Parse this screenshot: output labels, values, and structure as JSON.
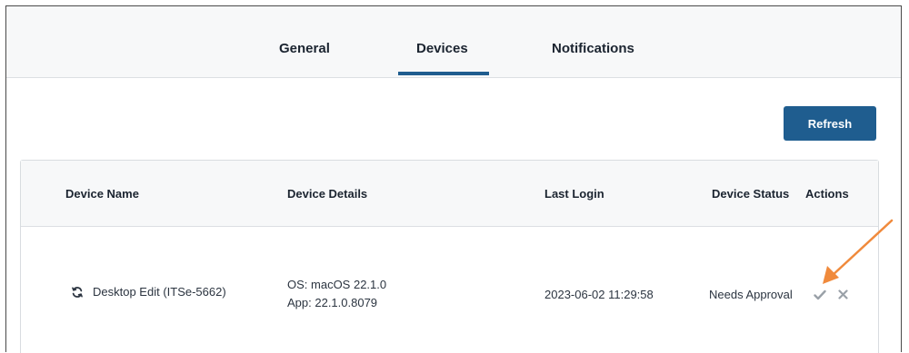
{
  "tabs": [
    {
      "label": "General",
      "active": false
    },
    {
      "label": "Devices",
      "active": true
    },
    {
      "label": "Notifications",
      "active": false
    }
  ],
  "toolbar": {
    "refresh_label": "Refresh"
  },
  "table": {
    "headers": [
      "Device Name",
      "Device Details",
      "Last Login",
      "Device Status",
      "Actions"
    ],
    "rows": [
      {
        "device_name": "Desktop Edit (ITSe-5662)",
        "details_os": "OS: macOS 22.1.0",
        "details_app": "App: 22.1.0.8079",
        "last_login": "2023-06-02 11:29:58",
        "status": "Needs Approval",
        "actions": [
          "approve-icon",
          "deny-icon"
        ]
      }
    ]
  },
  "colors": {
    "accent": "#1f5d8f",
    "annotation": "#f08a3c",
    "action_icon": "#9aa1a8"
  }
}
